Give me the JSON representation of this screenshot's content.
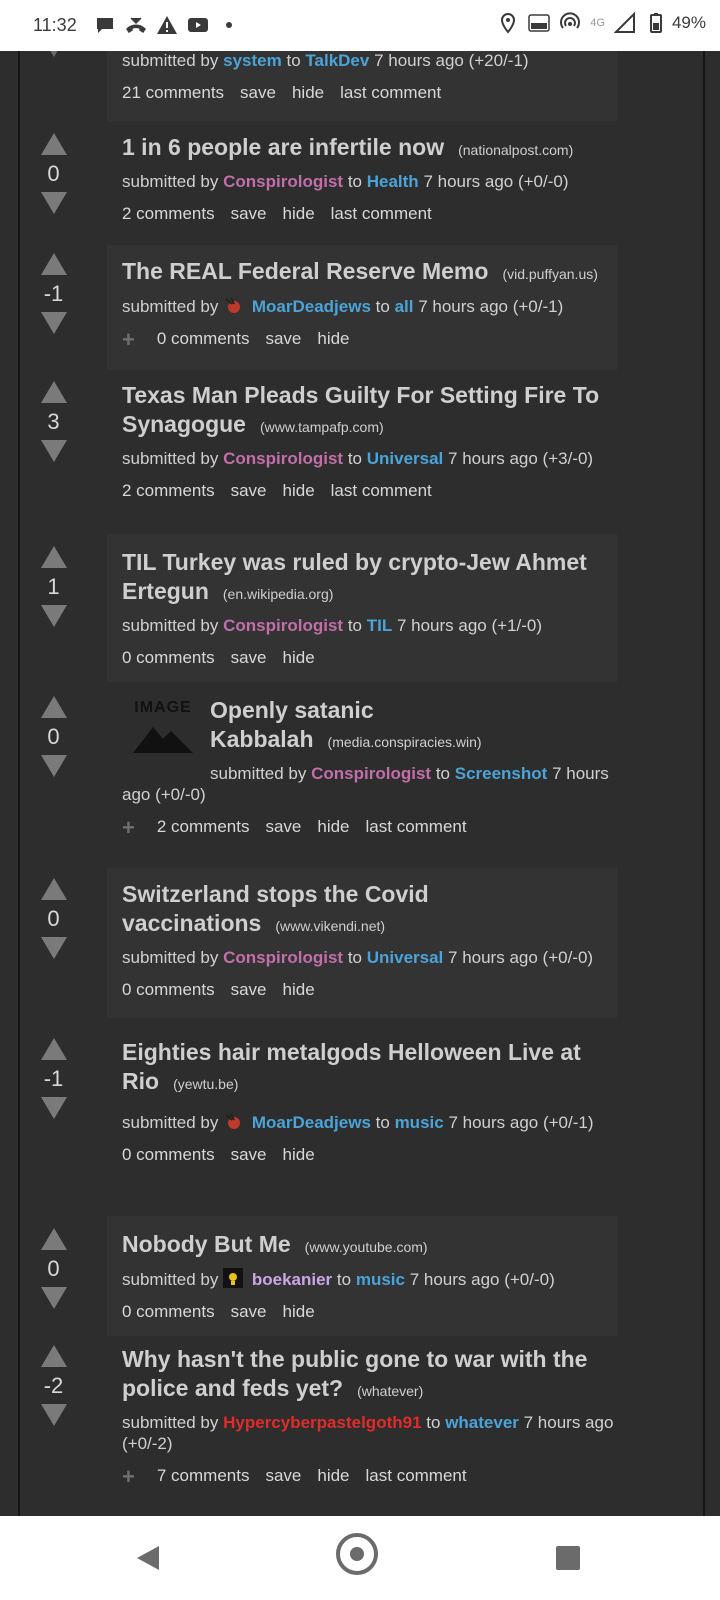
{
  "status_bar": {
    "time": "11:32",
    "network": "4G",
    "battery": "49%"
  },
  "posts": [
    {
      "submitted_prefix": "submitted by",
      "user": "system",
      "to": "to",
      "sub": "TalkDev",
      "time": "7 hours ago (+20/-1)",
      "comments": "21 comments",
      "save": "save",
      "hide": "hide",
      "last": "last comment"
    },
    {
      "score": "0",
      "title": "1 in 6 people are infertile now",
      "domain": "(nationalpost.com)",
      "submitted_prefix": "submitted by",
      "user": "Conspirologist",
      "to": "to",
      "sub": "Health",
      "time": "7 hours ago (+0/-0)",
      "comments": "2 comments",
      "save": "save",
      "hide": "hide",
      "last": "last comment"
    },
    {
      "score": "-1",
      "title": "The REAL Federal Reserve Memo",
      "domain": "(vid.puffyan.us)",
      "submitted_prefix": "submitted by",
      "user": "MoarDeadjews",
      "to": "to",
      "sub": "all",
      "time": "7 hours ago (+0/-1)",
      "comments": "0 comments",
      "save": "save",
      "hide": "hide"
    },
    {
      "score": "3",
      "title": "Texas Man Pleads Guilty For Setting Fire To Synagogue",
      "domain": "(www.tampafp.com)",
      "submitted_prefix": "submitted by",
      "user": "Conspirologist",
      "to": "to",
      "sub": "Universal",
      "time": "7 hours ago (+3/-0)",
      "comments": "2 comments",
      "save": "save",
      "hide": "hide",
      "last": "last comment"
    },
    {
      "score": "1",
      "title": "TIL Turkey was ruled by crypto-Jew Ahmet Ertegun",
      "domain": "(en.wikipedia.org)",
      "submitted_prefix": "submitted by",
      "user": "Conspirologist",
      "to": "to",
      "sub": "TIL",
      "time": "7 hours ago (+1/-0)",
      "comments": "0 comments",
      "save": "save",
      "hide": "hide"
    },
    {
      "score": "0",
      "thumb_label": "IMAGE",
      "title": "Openly satanic Kabbalah",
      "domain": "(media.conspiracies.win)",
      "submitted_prefix": "submitted by",
      "user": "Conspirologist",
      "to": "to",
      "sub": "Screenshot",
      "time": "7 hours ago (+0/-0)",
      "comments": "2 comments",
      "save": "save",
      "hide": "hide",
      "last": "last comment"
    },
    {
      "score": "0",
      "title": "Switzerland stops the Covid vaccinations",
      "domain": "(www.vikendi.net)",
      "submitted_prefix": "submitted by",
      "user": "Conspirologist",
      "to": "to",
      "sub": "Universal",
      "time": "7 hours ago (+0/-0)",
      "comments": "0 comments",
      "save": "save",
      "hide": "hide"
    },
    {
      "score": "-1",
      "title": "Eighties hair metalgods Helloween Live at Rio",
      "domain": "(yewtu.be)",
      "submitted_prefix": "submitted by",
      "user": "MoarDeadjews",
      "to": "to",
      "sub": "music",
      "time": "7 hours ago (+0/-1)",
      "comments": "0 comments",
      "save": "save",
      "hide": "hide"
    },
    {
      "score": "0",
      "title": "Nobody But Me",
      "domain": "(www.youtube.com)",
      "submitted_prefix": "submitted by",
      "user": "boekanier",
      "to": "to",
      "sub": "music",
      "time": "7 hours ago (+0/-0)",
      "comments": "0 comments",
      "save": "save",
      "hide": "hide"
    },
    {
      "score": "-2",
      "title": "Why hasn't the public gone to war with the police and feds yet?",
      "domain": "(whatever)",
      "submitted_prefix": "submitted by",
      "user": "Hypercyberpastelgoth91",
      "to": "to",
      "sub": "whatever",
      "time": "7 hours ago (+0/-2)",
      "comments": "7 comments",
      "save": "save",
      "hide": "hide",
      "last": "last comment"
    }
  ]
}
